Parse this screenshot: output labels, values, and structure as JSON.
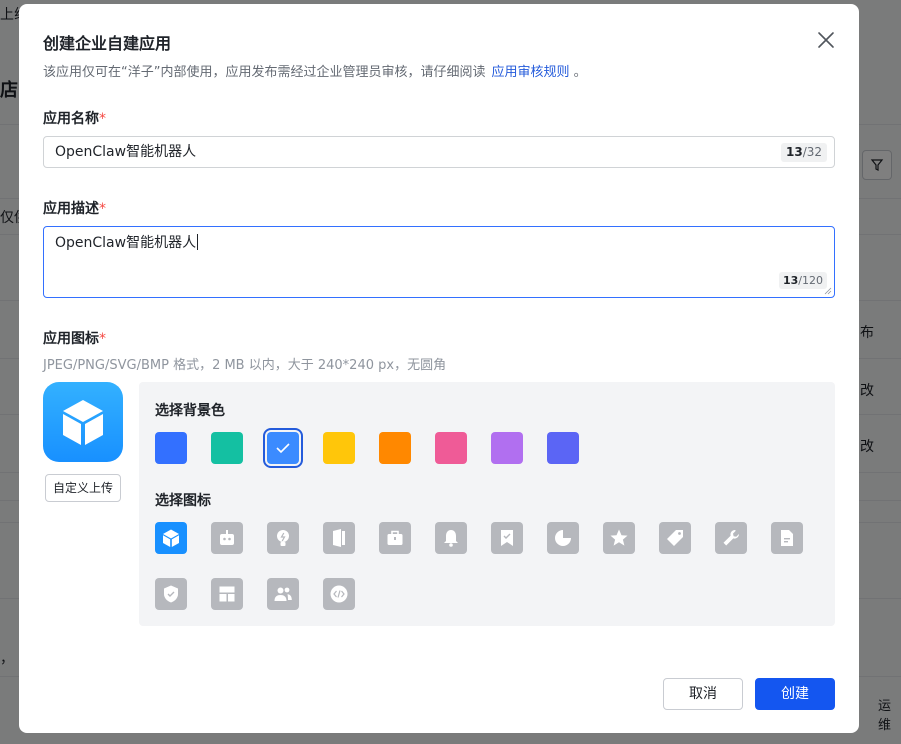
{
  "background": {
    "fragments": [
      "上线",
      "店",
      "仅供",
      "布",
      "改",
      "改",
      "，",
      "运维"
    ]
  },
  "dialog": {
    "title": "创建企业自建应用",
    "subtitle": "该应用仅可在“洋子”内部使用，应用发布需经过企业管理员审核，请仔细阅读",
    "subtitle_link": "应用审核规则",
    "subtitle_end": "。",
    "close_icon": "close-icon"
  },
  "name_field": {
    "label": "应用名称",
    "required_mark": "*",
    "value": "OpenClaw智能机器人",
    "count": "13",
    "max": "/32"
  },
  "desc_field": {
    "label": "应用描述",
    "required_mark": "*",
    "value": "OpenClaw智能机器人",
    "count": "13",
    "max": "/120"
  },
  "icon_field": {
    "label": "应用图标",
    "required_mark": "*",
    "hint": "JPEG/PNG/SVG/BMP 格式，2 MB 以内，大于 240*240 px，无圆角",
    "upload_label": "自定义上传",
    "bg_label": "选择背景色",
    "icon_label": "选择图标",
    "bg_colors": [
      "#3370ff",
      "#14c0a2",
      "#3b8bff",
      "#ffc60a",
      "#ff8800",
      "#ef5b97",
      "#b16ff0",
      "#5b65f5"
    ],
    "selected_bg": 2,
    "icons": [
      "cube-icon",
      "robot-icon",
      "bulb-icon",
      "door-icon",
      "briefcase-icon",
      "bell-icon",
      "bookmark-icon",
      "pie-icon",
      "star-icon",
      "tag-icon",
      "wrench-icon",
      "document-icon",
      "shield-icon",
      "layout-icon",
      "users-icon",
      "code-icon"
    ],
    "selected_icon": 0
  },
  "footer": {
    "cancel_label": "取消",
    "create_label": "创建"
  }
}
